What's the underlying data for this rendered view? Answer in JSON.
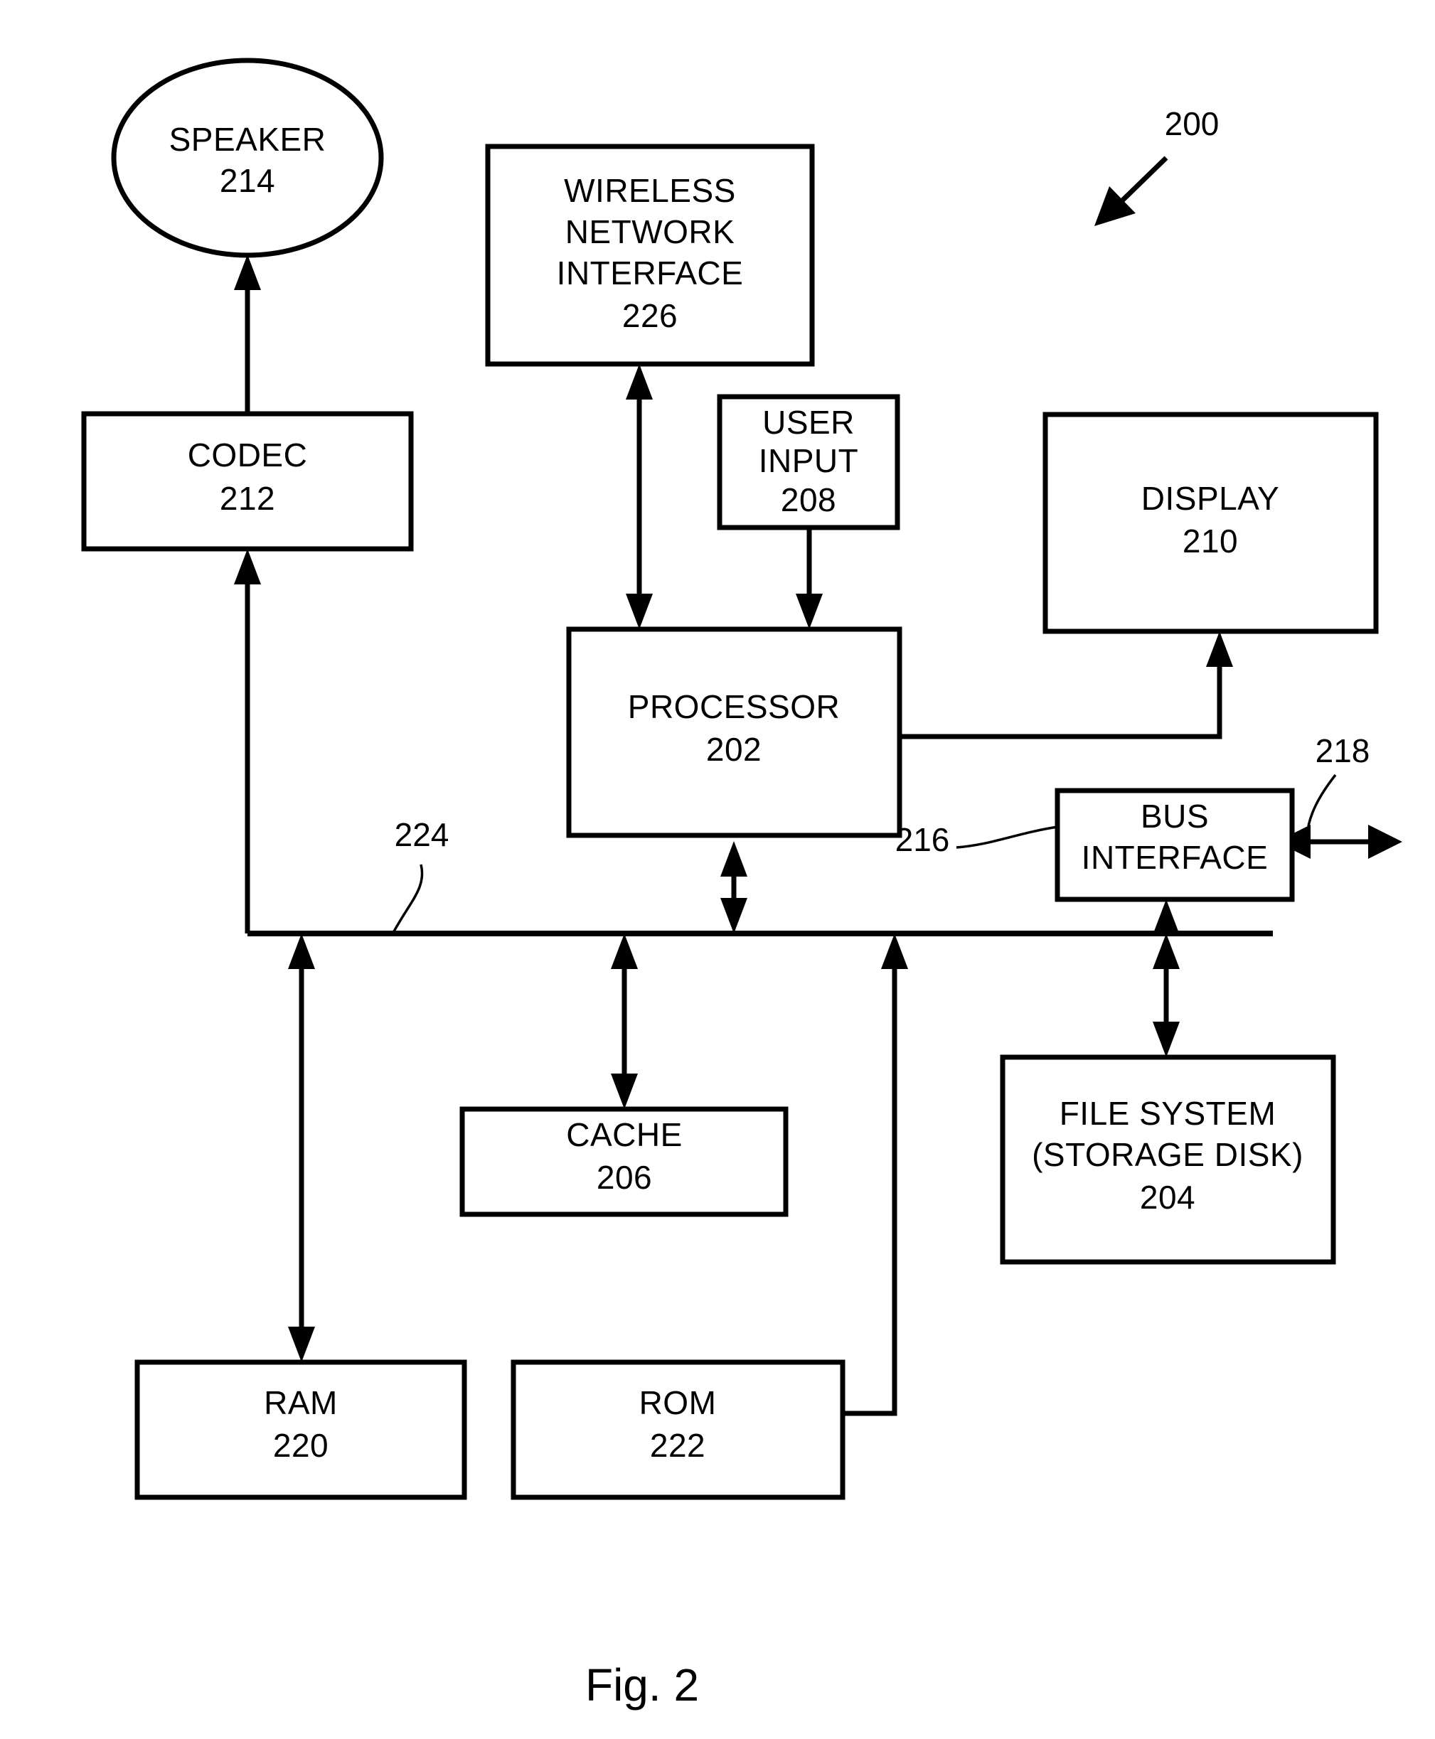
{
  "figure": {
    "caption": "Fig. 2",
    "system_reference": "200"
  },
  "nodes": [
    {
      "id": "speaker",
      "shape": "ellipse",
      "lines": [
        "SPEAKER",
        "214"
      ],
      "title": "SPEAKER",
      "ref": "214"
    },
    {
      "id": "wireless-network-interface",
      "shape": "rect",
      "lines": [
        "WIRELESS",
        "NETWORK",
        "INTERFACE",
        "226"
      ],
      "title": "WIRELESS NETWORK INTERFACE",
      "ref": "226"
    },
    {
      "id": "codec",
      "shape": "rect",
      "lines": [
        "CODEC",
        "212"
      ],
      "title": "CODEC",
      "ref": "212"
    },
    {
      "id": "user-input",
      "shape": "rect",
      "lines": [
        "USER",
        "INPUT",
        "208"
      ],
      "title": "USER INPUT",
      "ref": "208"
    },
    {
      "id": "display",
      "shape": "rect",
      "lines": [
        "DISPLAY",
        "210"
      ],
      "title": "DISPLAY",
      "ref": "210"
    },
    {
      "id": "processor",
      "shape": "rect",
      "lines": [
        "PROCESSOR",
        "202"
      ],
      "title": "PROCESSOR",
      "ref": "202"
    },
    {
      "id": "bus-interface",
      "shape": "rect",
      "lines": [
        "BUS",
        "INTERFACE"
      ],
      "title": "BUS INTERFACE",
      "ref": "218"
    },
    {
      "id": "cache",
      "shape": "rect",
      "lines": [
        "CACHE",
        "206"
      ],
      "title": "CACHE",
      "ref": "206"
    },
    {
      "id": "file-system",
      "shape": "rect",
      "lines": [
        "FILE SYSTEM",
        "(STORAGE DISK)",
        "204"
      ],
      "title": "FILE SYSTEM (STORAGE DISK)",
      "ref": "204"
    },
    {
      "id": "ram",
      "shape": "rect",
      "lines": [
        "RAM",
        "220"
      ],
      "title": "RAM",
      "ref": "220"
    },
    {
      "id": "rom",
      "shape": "rect",
      "lines": [
        "ROM",
        "222"
      ],
      "title": "ROM",
      "ref": "222"
    }
  ],
  "labels": {
    "speaker_line1": "SPEAKER",
    "speaker_line2": "214",
    "wni_line1": "WIRELESS",
    "wni_line2": "NETWORK",
    "wni_line3": "INTERFACE",
    "wni_line4": "226",
    "codec_line1": "CODEC",
    "codec_line2": "212",
    "userinput_line1": "USER",
    "userinput_line2": "INPUT",
    "userinput_line3": "208",
    "display_line1": "DISPLAY",
    "display_line2": "210",
    "processor_line1": "PROCESSOR",
    "processor_line2": "202",
    "busif_line1": "BUS",
    "busif_line2": "INTERFACE",
    "cache_line1": "CACHE",
    "cache_line2": "206",
    "filesystem_line1": "FILE SYSTEM",
    "filesystem_line2": "(STORAGE DISK)",
    "filesystem_line3": "204",
    "ram_line1": "RAM",
    "ram_line2": "220",
    "rom_line1": "ROM",
    "rom_line2": "222",
    "ref_200": "200",
    "ref_216": "216",
    "ref_218": "218",
    "ref_224": "224",
    "caption": "Fig. 2"
  },
  "colors": {
    "stroke": "#000000",
    "fill": "#ffffff",
    "background": "#ffffff"
  }
}
